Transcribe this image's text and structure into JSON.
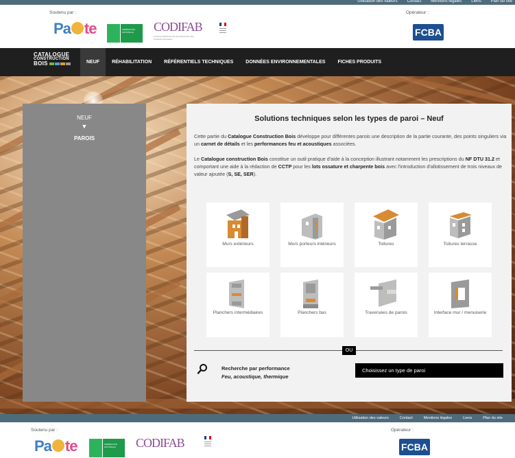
{
  "top_links": [
    "Utilisation des valeurs",
    "Contact",
    "Mentions légales",
    "Liens",
    "Plan du site"
  ],
  "sponsors": {
    "supported_label": "Soutenu par :",
    "operator_label": "Opérateur :",
    "pacte_pre": "Pa",
    "pacte_post": "te",
    "codifab": "CODIFAB",
    "fcba": "FCBA"
  },
  "brand": {
    "line1": "CATALOGUE",
    "line2": "CONSTRUCTION",
    "line3": "BOIS"
  },
  "nav": [
    "NEUF",
    "RÉHABILITATION",
    "RÉFÉRENTIELS TECHNIQUES",
    "DONNÉES ENVIRONNEMENTALES",
    "FICHES PRODUITS"
  ],
  "sidebar": {
    "level1": "NEUF",
    "arrow": "▼",
    "level2": "PAROIS"
  },
  "main": {
    "title": "Solutions techniques selon les types de paroi – Neuf",
    "p1": [
      {
        "t": "Cette partie du ",
        "b": false
      },
      {
        "t": "Catalogue Construction Bois",
        "b": true
      },
      {
        "t": " développe pour différentes parois une description de la partie courante, des points singuliers via un ",
        "b": false
      },
      {
        "t": "carnet de détails",
        "b": true
      },
      {
        "t": " et les ",
        "b": false
      },
      {
        "t": "performances feu et acoustiques",
        "b": true
      },
      {
        "t": " associées.",
        "b": false
      }
    ],
    "p2": [
      {
        "t": "Le ",
        "b": false
      },
      {
        "t": "Catalogue construction Bois",
        "b": true
      },
      {
        "t": " constitue un outil pratique d'aide à la conception illustrant notamment les prescriptions du ",
        "b": false
      },
      {
        "t": "NF DTU 31.2",
        "b": true
      },
      {
        "t": " et comportant une aide à la rédaction de ",
        "b": false
      },
      {
        "t": "CCTP",
        "b": true
      },
      {
        "t": " pour les ",
        "b": false
      },
      {
        "t": "lots ossature et charpente bois",
        "b": true
      },
      {
        "t": " avec l'introduction d'allotissement de trois niveaux de valeur ajoutée (",
        "b": false
      },
      {
        "t": "S, SE, SER",
        "b": true
      },
      {
        "t": ").",
        "b": false
      }
    ],
    "tiles": [
      {
        "label": "Murs extérieurs",
        "icon": "exterior-wall-icon"
      },
      {
        "label": "Murs porteurs intérieurs",
        "icon": "interior-wall-icon"
      },
      {
        "label": "Toitures",
        "icon": "roof-icon"
      },
      {
        "label": "Toitures terrasse",
        "icon": "flat-roof-icon"
      },
      {
        "label": "Planchers intermédiaires",
        "icon": "intermediate-floor-icon"
      },
      {
        "label": "Planchers bas",
        "icon": "low-floor-icon"
      },
      {
        "label": "Traversées de parois",
        "icon": "wall-crossing-icon"
      },
      {
        "label": "Interface mur / menuiserie",
        "icon": "window-interface-icon"
      }
    ],
    "ou": "OU",
    "search_title": "Recherche par performance",
    "search_sub": "Feu, acoustique, thermique",
    "select_placeholder": "Choisissez un type de paroi"
  },
  "colors": {
    "wood_orange": "#d98a33",
    "wall_grey": "#9a9a9a",
    "bar_blue": "#4e6b7c"
  }
}
